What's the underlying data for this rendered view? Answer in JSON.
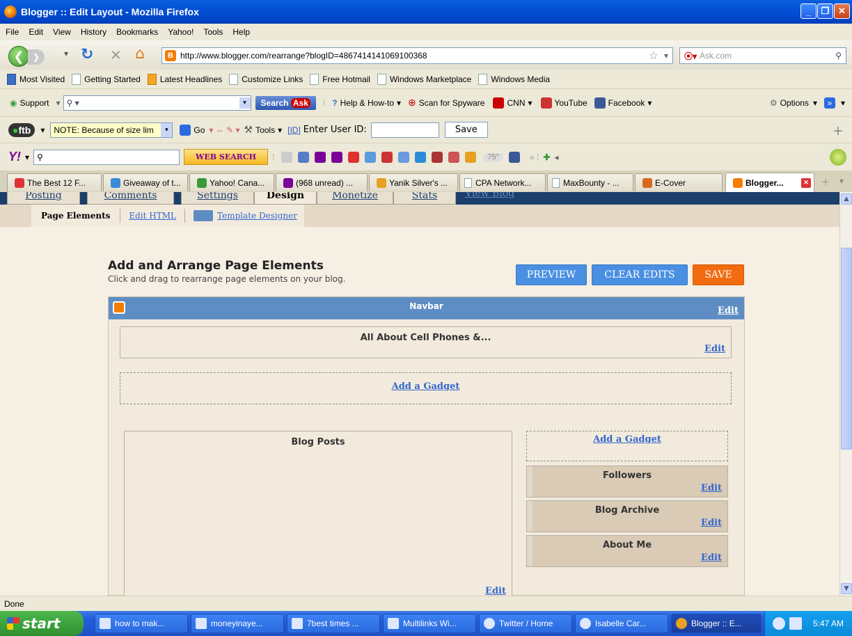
{
  "window": {
    "title": "Blogger :: Edit Layout - Mozilla Firefox"
  },
  "menu": [
    "File",
    "Edit",
    "View",
    "History",
    "Bookmarks",
    "Yahoo!",
    "Tools",
    "Help"
  ],
  "nav": {
    "url": "http://www.blogger.com/rearrange?blogID=4867414141069100368",
    "search_placeholder": "Ask.com"
  },
  "bookmarks": [
    "Most Visited",
    "Getting Started",
    "Latest Headlines",
    "Customize Links",
    "Free Hotmail",
    "Windows Marketplace",
    "Windows Media"
  ],
  "asktoolbar": {
    "support": "Support",
    "search": "Search",
    "helphowto": "Help & How-to",
    "scan": "Scan for Spyware",
    "cnn": "CNN",
    "youtube": "YouTube",
    "facebook": "Facebook",
    "options": "Options"
  },
  "ftbtoolbar": {
    "logo": "ftb",
    "note": "NOTE: Because of size lim",
    "go": "Go",
    "tools": "Tools",
    "id": "[ID]",
    "enter_id": "Enter User ID:",
    "save": "Save"
  },
  "yahootoolbar": {
    "logo": "Y!",
    "websearch": "WEB SEARCH",
    "temp": "75°"
  },
  "tabs": [
    "The Best 12 F...",
    "Giveaway of t...",
    "Yahoo! Cana...",
    "(968 unread) ...",
    "Yanik Silver's ...",
    "CPA Network...",
    "MaxBounty - ...",
    "E-Cover",
    "Blogger..."
  ],
  "blogger": {
    "tabs": [
      "Posting",
      "Comments",
      "Settings",
      "Design",
      "Monetize",
      "Stats",
      "View Blog"
    ],
    "subtabs": {
      "page_elements": "Page Elements",
      "edit_html": "Edit HTML",
      "template_designer": "Template Designer"
    },
    "heading": "Add and Arrange Page Elements",
    "subheading": "Click and drag to rearrange page elements on your blog.",
    "buttons": {
      "preview": "PREVIEW",
      "clear": "CLEAR EDITS",
      "save": "SAVE"
    },
    "navbar": {
      "title": "Navbar",
      "edit": "Edit"
    },
    "header": {
      "title": "All About Cell Phones &...",
      "edit": "Edit"
    },
    "add_gadget": "Add a Gadget",
    "blog_posts": {
      "title": "Blog Posts",
      "edit": "Edit"
    },
    "sidebar": [
      {
        "title": "Followers",
        "edit": "Edit"
      },
      {
        "title": "Blog Archive",
        "edit": "Edit"
      },
      {
        "title": "About Me",
        "edit": "Edit"
      }
    ]
  },
  "status": "Done",
  "taskbar": {
    "start": "start",
    "items": [
      "how to mak...",
      "moneyinaye...",
      "7best times ...",
      "Multilinks Wi...",
      "Twitter / Home",
      "Isabelle Car...",
      "Blogger :: E..."
    ],
    "time": "5:47 AM"
  },
  "colors": {
    "xp_blue": "#0450D6",
    "blogger_orange": "#F57D00",
    "button_blue": "#4A90E2",
    "save_orange": "#F26B0F",
    "navbar_blue": "#5E8DC4",
    "link_blue": "#3366CC",
    "layout_bg": "#F5EFE4"
  }
}
